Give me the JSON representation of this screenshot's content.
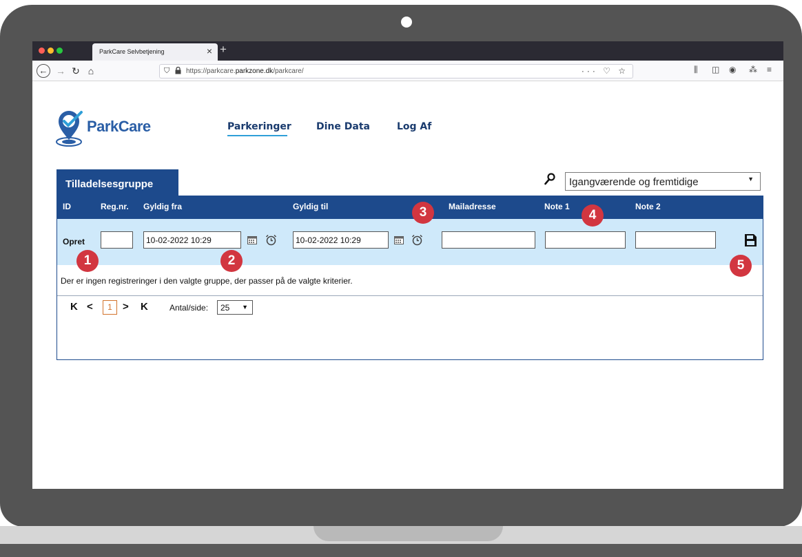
{
  "browser": {
    "tab_title": "ParkCare Selvbetjening",
    "tab_close": "×",
    "new_tab": "+",
    "url_prefix": "https://parkcare.",
    "url_host": "parkzone.dk",
    "url_suffix": "/parkcare/",
    "url_actions": "··· ♡ ☆"
  },
  "logo": {
    "part1": "Park",
    "part2": "Care"
  },
  "nav": {
    "parkeringer": "Parkeringer",
    "dine_data": "Dine Data",
    "log_af": "Log Af"
  },
  "group": {
    "title": "Tilladelsesgruppe"
  },
  "filter": {
    "selected": "Igangværende og fremtidige"
  },
  "grid": {
    "columns": {
      "id": "ID",
      "reg": "Reg.nr.",
      "gyldig_fra": "Gyldig fra",
      "gyldig_til": "Gyldig til",
      "mail": "Mailadresse",
      "note1": "Note 1",
      "note2": "Note 2"
    },
    "create_label": "Opret",
    "gyldig_fra_value": "10-02-2022 10:29",
    "gyldig_til_value": "10-02-2022 10:29",
    "empty_message": "Der er ingen registreringer i den valgte gruppe, der passer på de valgte kriterier."
  },
  "pager": {
    "first": "K",
    "prev": "<",
    "current": "1",
    "next": ">",
    "last": "K",
    "per_page_label": "Antal/side:",
    "per_page_value": "25"
  },
  "markers": [
    "1",
    "2",
    "3",
    "4",
    "5"
  ],
  "colors": {
    "header_blue": "#1d4a8c",
    "row_light_blue": "#cfe9fa",
    "marker_red": "#d23640",
    "nav_underline": "#2f9fd8"
  }
}
